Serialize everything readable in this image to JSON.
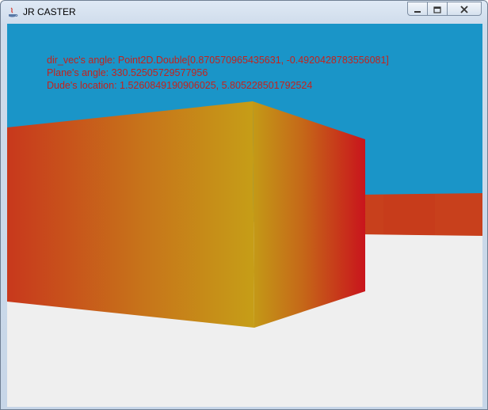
{
  "window": {
    "title": "JR CASTER",
    "controls": [
      "minimize",
      "maximize",
      "close"
    ]
  },
  "hud": {
    "dir_vec": "dir_vec's angle: Point2D.Double[0.870570965435631, -0.4920428783556081]",
    "plane_angle": "Plane's angle: 330.52505729577956",
    "dude_location": "Dude's location: 1.5260849190906025, 5.805228501792524"
  },
  "scene": {
    "sky_color": "#1a95c8",
    "floor_color": "#efefef",
    "wall_colors": [
      "#c8381c",
      "#c49a17",
      "#c9141c"
    ]
  }
}
